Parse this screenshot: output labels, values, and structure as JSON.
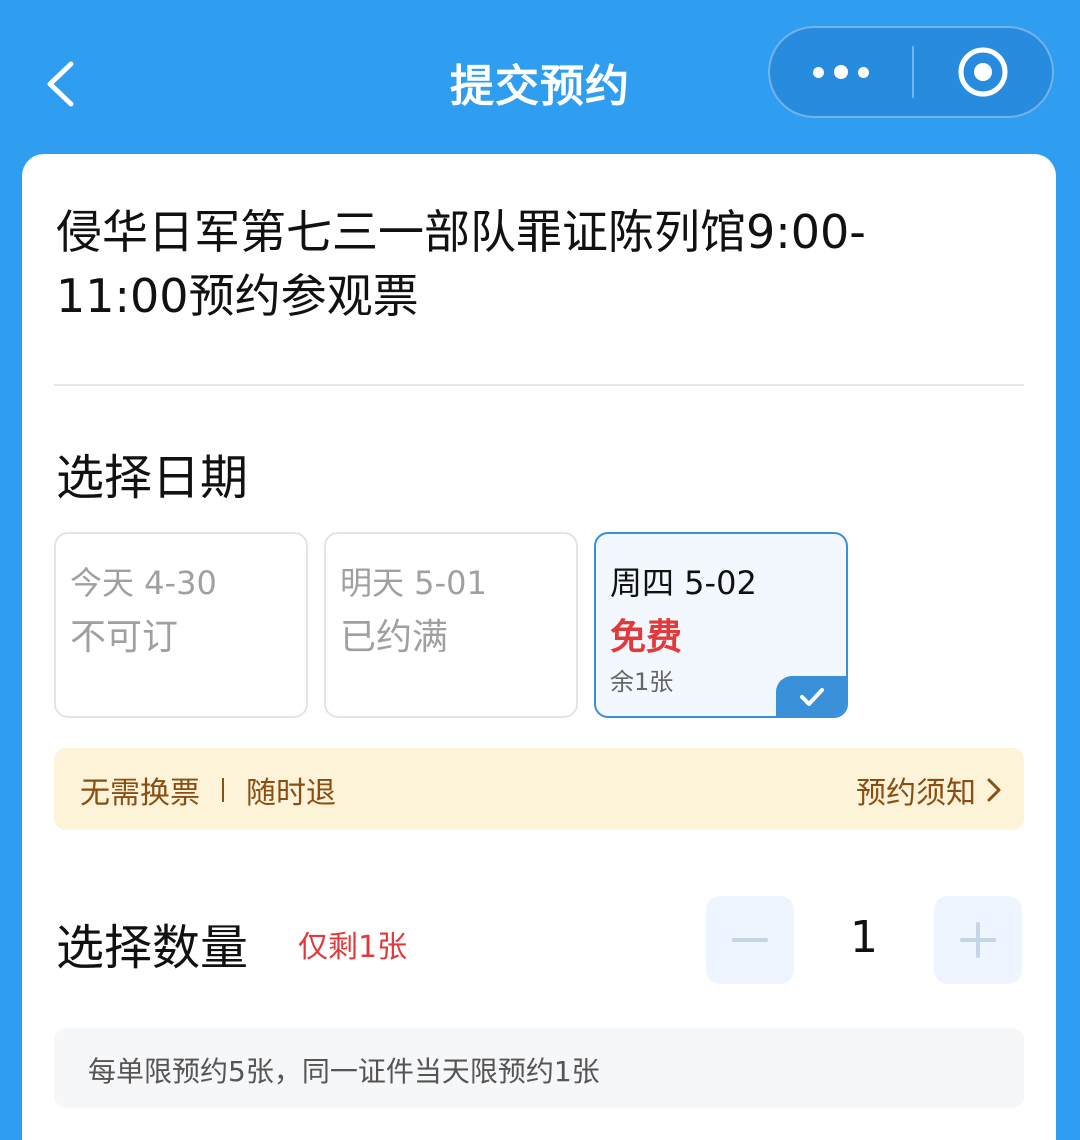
{
  "navbar": {
    "title": "提交预约",
    "back_icon": "chevron-left-icon",
    "more_icon": "more-dots-icon",
    "close_icon": "target-circle-icon"
  },
  "product": {
    "title": "侵华日军第七三一部队罪证陈列馆9:00-11:00预约参观票"
  },
  "date_section": {
    "title": "选择日期",
    "options": [
      {
        "label": "今天 4-30",
        "status": "不可订",
        "available": false
      },
      {
        "label": "明天 5-01",
        "status": "已约满",
        "available": false
      },
      {
        "label": "周四 5-02",
        "status": "免费",
        "remain": "余1张",
        "available": true,
        "selected": true
      }
    ]
  },
  "notice": {
    "tag1": "无需换票",
    "tag2": "随时退",
    "link": "预约须知"
  },
  "quantity_section": {
    "title": "选择数量",
    "remain_tag": "仅剩1张",
    "value": "1"
  },
  "limit_note": "每单限预约5张，同一证件当天限预约1张",
  "colors": {
    "nav_bg": "#2f9df0",
    "accent": "#3a8fd9",
    "price_red": "#e23a3a",
    "notice_bg": "#fdf3d8",
    "notice_text": "#8a4d12"
  }
}
